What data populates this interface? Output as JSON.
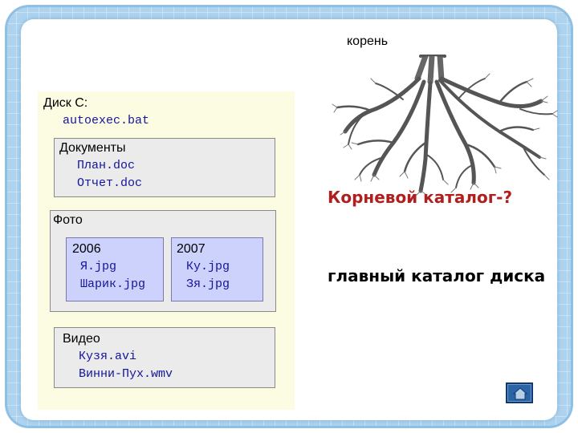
{
  "root_caption": "корень",
  "disk": {
    "title": "Диск С:",
    "file": "autoexec.bat"
  },
  "documents": {
    "title": "Документы",
    "files": [
      "План.doc",
      "Отчет.doc"
    ]
  },
  "photo": {
    "title": "Фото",
    "folders": [
      {
        "title": "2006",
        "files": [
          "Я.jpg",
          "Шарик.jpg"
        ]
      },
      {
        "title": "2007",
        "files": [
          "Ку.jpg",
          "Зя.jpg"
        ]
      }
    ]
  },
  "video": {
    "title": "Видео",
    "files": [
      "Кузя.avi",
      "Винни-Пух.wmv"
    ]
  },
  "question": "Корневой каталог-?",
  "answer": "главный каталог диска",
  "tree_icon": "tree-roots-illustration",
  "home_button_icon": "home-icon",
  "colors": {
    "question": "#b01e1e",
    "file_text": "#15159a",
    "panel_bg": "#fcfce3",
    "subfolder_bg": "#ccd2fb",
    "folder_bg": "#ebebeb"
  }
}
